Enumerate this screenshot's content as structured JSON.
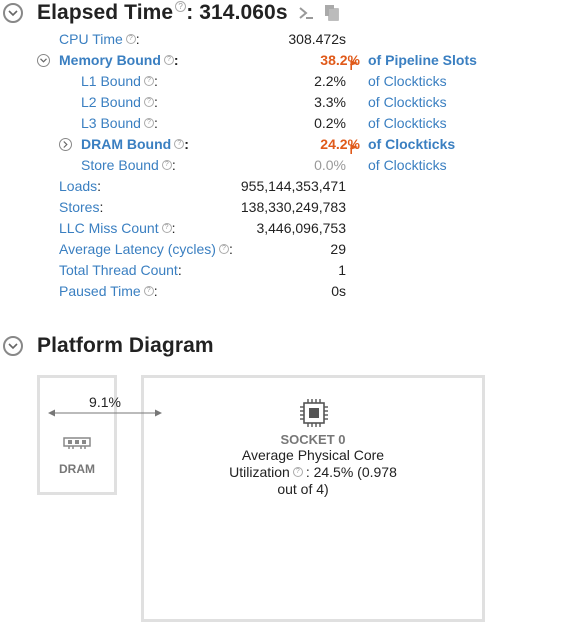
{
  "elapsed": {
    "title": "Elapsed Time",
    "value": ": 314.060s",
    "help_glyph": "?"
  },
  "metrics": [
    {
      "label": "CPU Time",
      "value": "308.472s",
      "unit": ""
    },
    {
      "label": "Memory Bound",
      "value": "38.2%",
      "unit": "of Pipeline Slots"
    },
    {
      "label": "L1 Bound",
      "value": "2.2%",
      "unit": "of Clockticks"
    },
    {
      "label": "L2 Bound",
      "value": "3.3%",
      "unit": "of Clockticks"
    },
    {
      "label": "L3 Bound",
      "value": "0.2%",
      "unit": "of Clockticks"
    },
    {
      "label": "DRAM Bound",
      "value": "24.2%",
      "unit": "of Clockticks"
    },
    {
      "label": "Store Bound",
      "value": "0.0%",
      "unit": "of Clockticks"
    },
    {
      "label": "Loads",
      "value": "955,144,353,471",
      "unit": ""
    },
    {
      "label": "Stores",
      "value": "138,330,249,783",
      "unit": ""
    },
    {
      "label": "LLC Miss Count",
      "value": "3,446,096,753",
      "unit": ""
    },
    {
      "label": "Average Latency (cycles)",
      "value": "29",
      "unit": ""
    },
    {
      "label": "Total Thread Count",
      "value": "1",
      "unit": ""
    },
    {
      "label": "Paused Time",
      "value": "0s",
      "unit": ""
    }
  ],
  "colon": ":",
  "platform": {
    "title": "Platform Diagram",
    "dram": {
      "label": "DRAM",
      "bandwidth": "9.1%"
    },
    "socket": {
      "label": "SOCKET 0",
      "util_line1": "Average Physical Core",
      "util_word": "Utilization",
      "util_value": ": 24.5% (0.978",
      "util_line3": "out of 4)"
    }
  },
  "colors": {
    "link": "#3a7fc1",
    "alert": "#e05a1a",
    "text": "#222222",
    "muted": "#999999",
    "box_border": "#e0e0e0"
  }
}
